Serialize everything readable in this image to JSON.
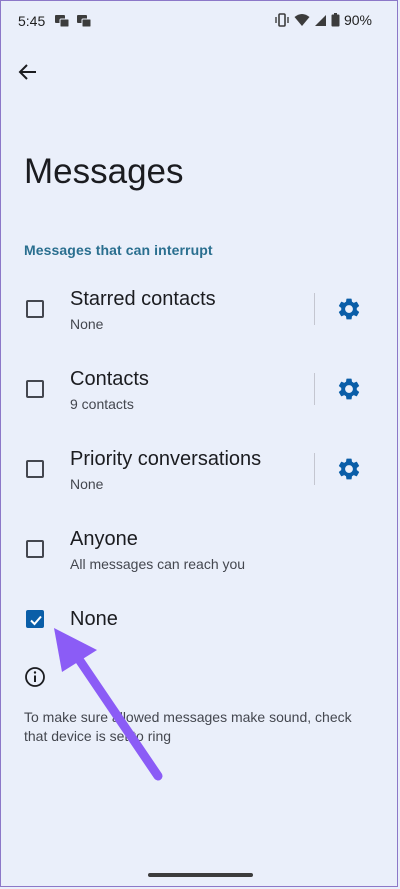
{
  "status_bar": {
    "time": "5:45",
    "notification_icons": [
      "message-icon",
      "message-icon"
    ],
    "battery": "90%"
  },
  "page": {
    "title": "Messages",
    "section_header": "Messages that can interrupt"
  },
  "options": [
    {
      "title": "Starred contacts",
      "subtitle": "None",
      "checked": false,
      "has_settings": true
    },
    {
      "title": "Contacts",
      "subtitle": "9 contacts",
      "checked": false,
      "has_settings": true
    },
    {
      "title": "Priority conversations",
      "subtitle": "None",
      "checked": false,
      "has_settings": true
    },
    {
      "title": "Anyone",
      "subtitle": "All messages can reach you",
      "checked": false,
      "has_settings": false
    },
    {
      "title": "None",
      "subtitle": "",
      "checked": true,
      "has_settings": false
    }
  ],
  "footer": {
    "info_text": "To make sure allowed messages make sound, check that device is set to ring"
  },
  "colors": {
    "background": "#eaeffa",
    "accent": "#0a5ea8",
    "section_header": "#2a6f8f",
    "annotation_arrow": "#8b5cf6"
  }
}
